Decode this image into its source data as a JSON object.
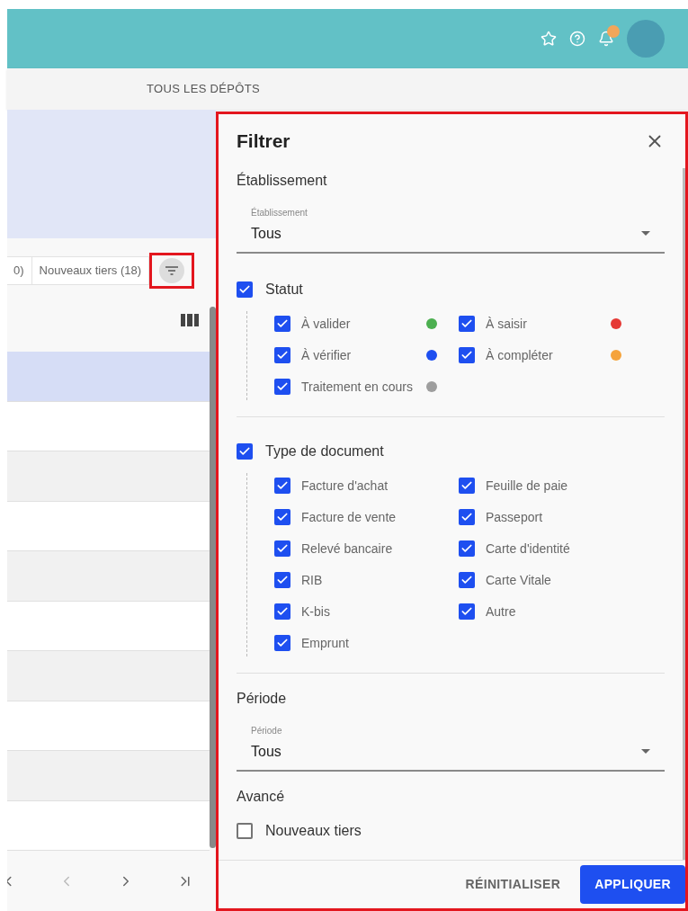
{
  "nav_tab": {
    "label": "TOUS LES DÉPÔTS"
  },
  "list": {
    "tabs": [
      {
        "label": "0)"
      },
      {
        "label": "Nouveaux tiers (18)"
      }
    ],
    "rows": [
      {
        "selected": true
      },
      {
        "selected": false
      },
      {
        "selected": false
      },
      {
        "selected": false
      },
      {
        "selected": false
      },
      {
        "selected": false
      },
      {
        "selected": false
      },
      {
        "selected": false
      },
      {
        "selected": false
      },
      {
        "selected": false
      }
    ]
  },
  "filter_panel": {
    "title": "Filtrer",
    "establishment": {
      "heading": "Établissement",
      "field_label": "Établissement",
      "value": "Tous"
    },
    "status": {
      "label": "Statut",
      "checked": true,
      "items": [
        {
          "label": "À valider",
          "checked": true,
          "color": "#4caf50"
        },
        {
          "label": "À saisir",
          "checked": true,
          "color": "#e53935"
        },
        {
          "label": "À vérifier",
          "checked": true,
          "color": "#1e4ff0"
        },
        {
          "label": "À compléter",
          "checked": true,
          "color": "#f5a33c"
        },
        {
          "label": "Traitement en cours",
          "checked": true,
          "color": "#9e9e9e"
        }
      ]
    },
    "document_type": {
      "label": "Type de document",
      "checked": true,
      "items": [
        {
          "label": "Facture d'achat",
          "checked": true
        },
        {
          "label": "Feuille de paie",
          "checked": true
        },
        {
          "label": "Facture de vente",
          "checked": true
        },
        {
          "label": "Passeport",
          "checked": true
        },
        {
          "label": "Relevé bancaire",
          "checked": true
        },
        {
          "label": "Carte d'identité",
          "checked": true
        },
        {
          "label": "RIB",
          "checked": true
        },
        {
          "label": "Carte Vitale",
          "checked": true
        },
        {
          "label": "K-bis",
          "checked": true
        },
        {
          "label": "Autre",
          "checked": true
        },
        {
          "label": "Emprunt",
          "checked": true
        }
      ]
    },
    "period": {
      "heading": "Période",
      "field_label": "Période",
      "value": "Tous"
    },
    "advanced": {
      "heading": "Avancé",
      "option": {
        "label": "Nouveaux tiers",
        "checked": false
      }
    },
    "buttons": [
      {
        "label": "RÉINITIALISER",
        "kind": "text"
      },
      {
        "label": "APPLIQUER",
        "kind": "primary"
      }
    ]
  }
}
